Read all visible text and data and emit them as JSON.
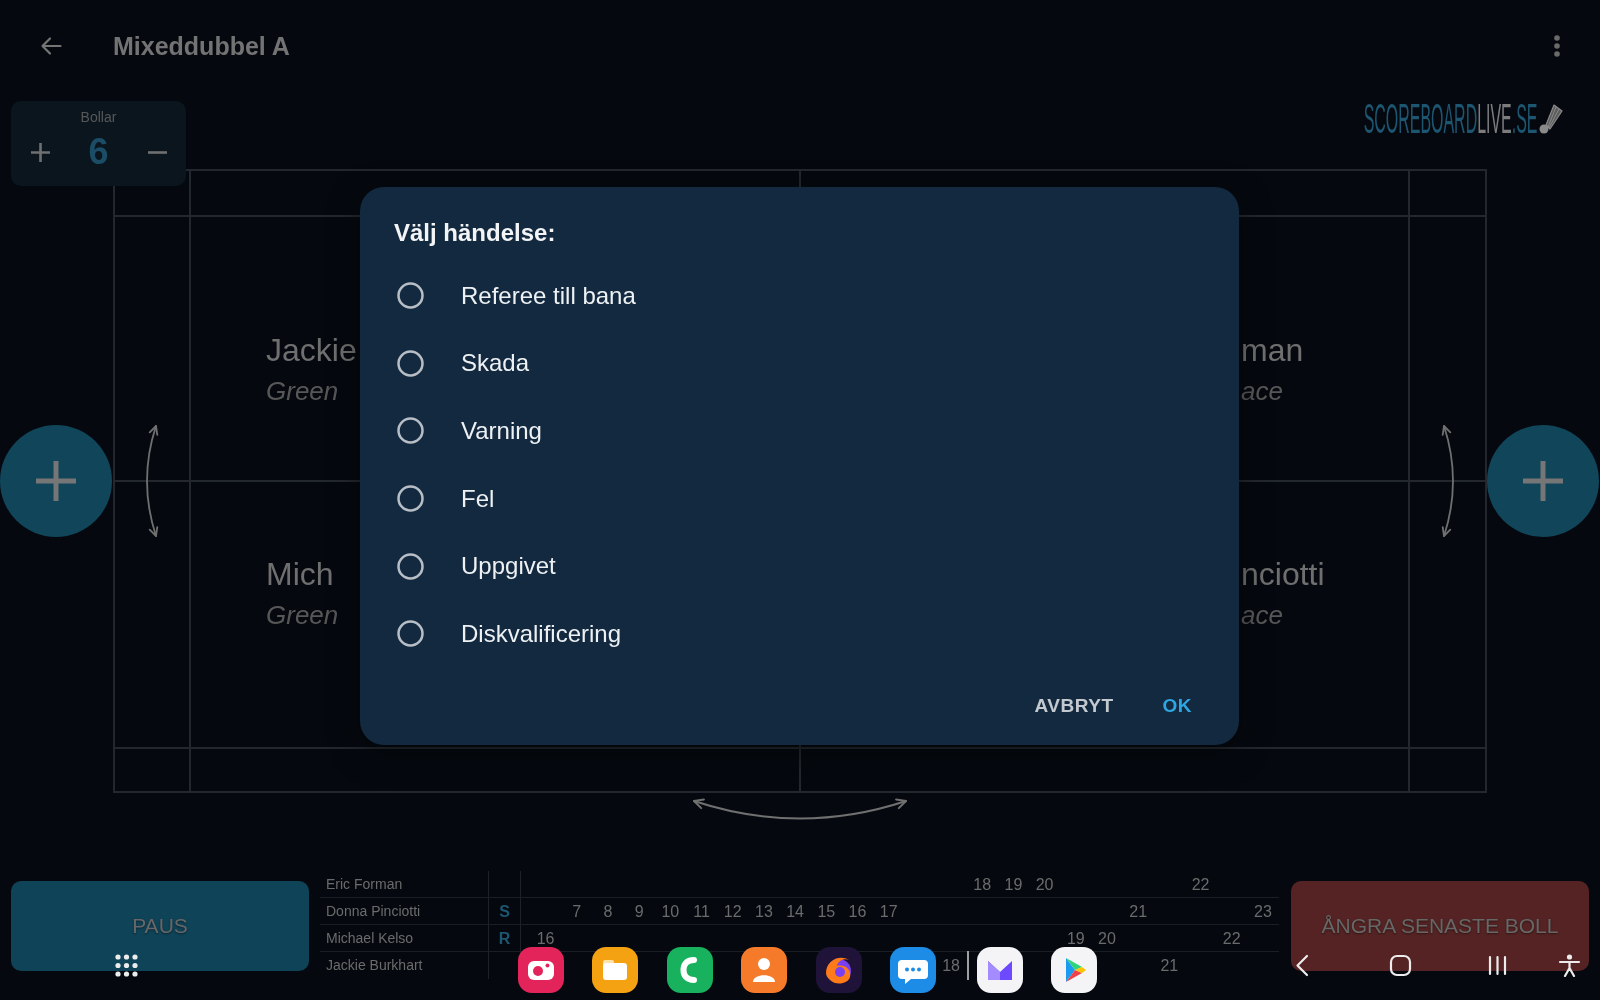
{
  "app_bar": {
    "title": "Mixeddubbel A"
  },
  "balls_counter": {
    "label": "Bollar",
    "value": "6"
  },
  "logo": {
    "brand": "SCOREBOARD",
    "accent": "LIVE",
    "domain": ".SE"
  },
  "court": {
    "players": [
      {
        "name": "Jackie",
        "team": "Green"
      },
      {
        "name": "man",
        "team": "ace"
      },
      {
        "name": "Mich",
        "team": "Green"
      },
      {
        "name": "nciotti",
        "team": "ace"
      }
    ]
  },
  "dialog": {
    "title": "Välj händelse:",
    "options": [
      {
        "label": "Referee till bana",
        "selected": false
      },
      {
        "label": "Skada",
        "selected": false
      },
      {
        "label": "Varning",
        "selected": false
      },
      {
        "label": "Fel",
        "selected": false
      },
      {
        "label": "Uppgivet",
        "selected": false
      },
      {
        "label": "Diskvalificering",
        "selected": false
      }
    ],
    "buttons": [
      {
        "label": "AVBRYT",
        "kind": "secondary"
      },
      {
        "label": "OK",
        "kind": "primary"
      }
    ]
  },
  "pause_button": {
    "label": "PAUS"
  },
  "score_sheet": {
    "rows": [
      {
        "name": "Eric Forman",
        "cells": [
          null,
          null,
          null,
          null,
          null,
          null,
          null,
          null,
          null,
          null,
          null,
          null,
          null,
          null,
          "18",
          "19",
          "20",
          null,
          null,
          null,
          null,
          "22",
          null,
          null
        ]
      },
      {
        "name": "Donna Pinciotti",
        "role": "S",
        "cells": [
          null,
          "7",
          "8",
          "9",
          "10",
          "11",
          "12",
          "13",
          "14",
          "15",
          "16",
          "17",
          null,
          null,
          null,
          null,
          null,
          null,
          null,
          "21",
          null,
          null,
          null,
          "23"
        ]
      },
      {
        "name": "Michael Kelso",
        "role": "R",
        "cells": [
          "16",
          null,
          null,
          null,
          null,
          null,
          null,
          null,
          null,
          null,
          null,
          null,
          null,
          null,
          null,
          null,
          null,
          "19",
          "20",
          null,
          null,
          null,
          "22",
          null
        ]
      },
      {
        "name": "Jackie Burkhart",
        "cells": [
          null,
          null,
          null,
          null,
          null,
          null,
          null,
          null,
          null,
          null,
          null,
          null,
          null,
          "18",
          null,
          null,
          null,
          null,
          null,
          null,
          "21",
          null,
          null,
          null
        ]
      }
    ]
  },
  "undo_button": {
    "label": "ÅNGRA SENASTE BOLL"
  }
}
